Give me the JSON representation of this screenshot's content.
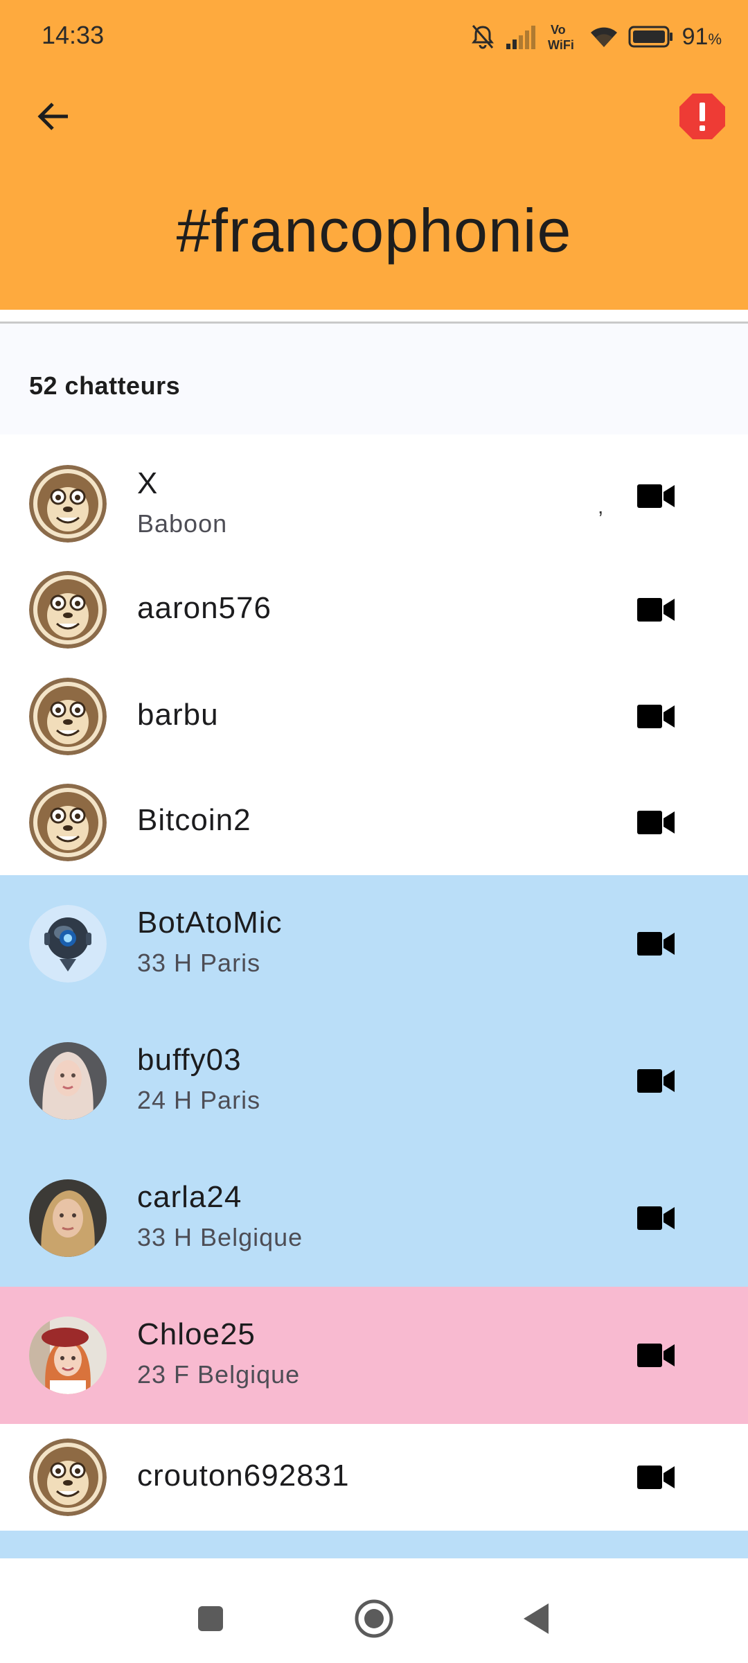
{
  "status_bar": {
    "time": "14:33",
    "battery": "91",
    "battery_unit": "%"
  },
  "header": {
    "channel": "#francophonie",
    "bg_color": "#FEAA3E"
  },
  "member_count": "52 chatteurs",
  "row_colors": {
    "neutral": "#FFFFFF",
    "male": "#BADEF8",
    "female": "#F8BAD0"
  },
  "users": [
    {
      "name": "X",
      "subtitle": "Baboon",
      "extra": ",",
      "avatar": "baboon-icon",
      "gender": "neutral"
    },
    {
      "name": "aaron576",
      "subtitle": "",
      "avatar": "baboon-icon",
      "gender": "neutral"
    },
    {
      "name": "barbu",
      "subtitle": "",
      "avatar": "baboon-icon",
      "gender": "neutral"
    },
    {
      "name": "Bitcoin2",
      "subtitle": "",
      "avatar": "baboon-icon",
      "gender": "neutral"
    },
    {
      "name": "BotAtoMic",
      "subtitle": "33 H Paris",
      "avatar": "robot-photo",
      "gender": "male"
    },
    {
      "name": "buffy03",
      "subtitle": "24 H Paris",
      "avatar": "blonde-woman-photo",
      "gender": "male"
    },
    {
      "name": "carla24",
      "subtitle": "33 H Belgique",
      "avatar": "woman-photo",
      "gender": "male"
    },
    {
      "name": "Chloe25",
      "subtitle": "23 F Belgique",
      "avatar": "redhead-beret-photo",
      "gender": "female"
    },
    {
      "name": "crouton692831",
      "subtitle": "",
      "avatar": "baboon-icon",
      "gender": "neutral"
    }
  ]
}
